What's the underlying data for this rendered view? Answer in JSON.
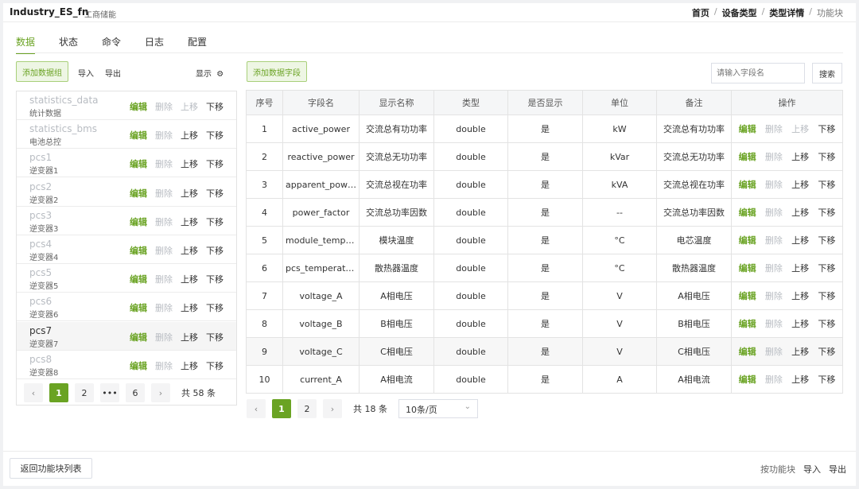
{
  "app": {
    "title": "Industry_ES_fn",
    "subtitle": "工商储能"
  },
  "breadcrumb": [
    "首页",
    "设备类型",
    "类型详情",
    "功能块"
  ],
  "tabs": [
    "数据",
    "状态",
    "命令",
    "日志",
    "配置"
  ],
  "left": {
    "add_group": "添加数据组",
    "import": "导入",
    "export": "导出",
    "display": "显示",
    "display_icon": "gear-icon",
    "groups": [
      {
        "name": "statistics_data",
        "sub": "统计数据",
        "up_disabled": true
      },
      {
        "name": "statistics_bms",
        "sub": "电池总控",
        "up_disabled": false
      },
      {
        "name": "pcs1",
        "sub": "逆变器1",
        "up_disabled": false
      },
      {
        "name": "pcs2",
        "sub": "逆变器2",
        "up_disabled": false
      },
      {
        "name": "pcs3",
        "sub": "逆变器3",
        "up_disabled": false
      },
      {
        "name": "pcs4",
        "sub": "逆变器4",
        "up_disabled": false
      },
      {
        "name": "pcs5",
        "sub": "逆变器5",
        "up_disabled": false
      },
      {
        "name": "pcs6",
        "sub": "逆变器6",
        "up_disabled": false
      },
      {
        "name": "pcs7",
        "sub": "逆变器7",
        "up_disabled": false
      },
      {
        "name": "pcs8",
        "sub": "逆变器8",
        "up_disabled": false
      }
    ],
    "actions": {
      "edit": "编辑",
      "delete": "删除",
      "up": "上移",
      "down": "下移"
    },
    "pager": {
      "prev": "‹",
      "pages": [
        "1",
        "2",
        "•••",
        "6"
      ],
      "next": "›",
      "total": "共 58 条"
    }
  },
  "right": {
    "add_field": "添加数据字段",
    "search_placeholder": "请输入字段名",
    "search_btn": "搜索",
    "columns": [
      "序号",
      "字段名",
      "显示名称",
      "类型",
      "是否显示",
      "单位",
      "备注",
      "操作"
    ],
    "rows": [
      [
        "1",
        "active_power",
        "交流总有功功率",
        "double",
        "是",
        "kW",
        "交流总有功功率"
      ],
      [
        "2",
        "reactive_power",
        "交流总无功功率",
        "double",
        "是",
        "kVar",
        "交流总无功功率"
      ],
      [
        "3",
        "apparent_power",
        "交流总视在功率",
        "double",
        "是",
        "kVA",
        "交流总视在功率"
      ],
      [
        "4",
        "power_factor",
        "交流总功率因数",
        "double",
        "是",
        "--",
        "交流总功率因数"
      ],
      [
        "5",
        "module_temperature",
        "模块温度",
        "double",
        "是",
        "°C",
        "电芯温度"
      ],
      [
        "6",
        "pcs_temperature",
        "散热器温度",
        "double",
        "是",
        "°C",
        "散热器温度"
      ],
      [
        "7",
        "voltage_A",
        "A相电压",
        "double",
        "是",
        "V",
        "A相电压"
      ],
      [
        "8",
        "voltage_B",
        "B相电压",
        "double",
        "是",
        "V",
        "B相电压"
      ],
      [
        "9",
        "voltage_C",
        "C相电压",
        "double",
        "是",
        "V",
        "C相电压"
      ],
      [
        "10",
        "current_A",
        "A相电流",
        "double",
        "是",
        "A",
        "A相电流"
      ]
    ],
    "pager": {
      "prev": "‹",
      "pages": [
        "1",
        "2"
      ],
      "next": "›",
      "total": "共 18 条",
      "page_size": "10条/页"
    }
  },
  "footer": {
    "back": "返回功能块列表",
    "by_block": "按功能块",
    "import": "导入",
    "export": "导出"
  }
}
